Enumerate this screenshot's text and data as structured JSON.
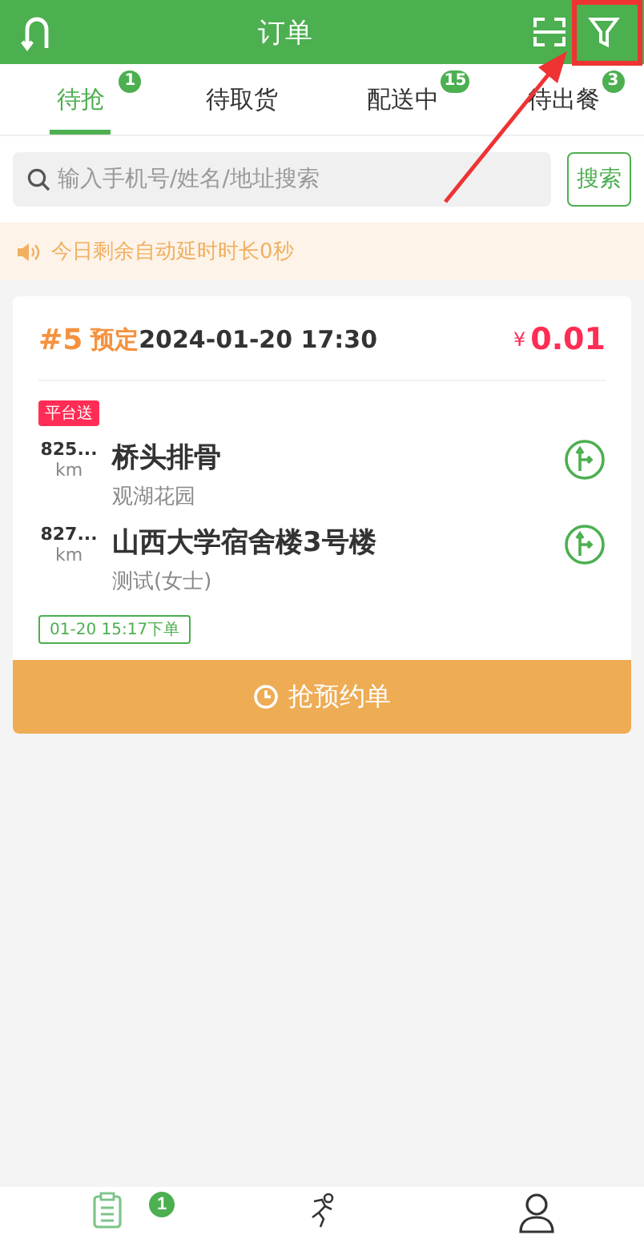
{
  "header": {
    "title": "订单"
  },
  "tabs": [
    {
      "label": "待抢",
      "badge": "1",
      "selected": true
    },
    {
      "label": "待取货",
      "selected": false
    },
    {
      "label": "配送中",
      "badge": "15",
      "selected": false
    },
    {
      "label": "待出餐",
      "badge": "3",
      "selected": false
    }
  ],
  "search": {
    "placeholder": "输入手机号/姓名/地址搜索",
    "button": "搜索"
  },
  "notice": "今日剩余自动延时时长0秒",
  "orders": [
    {
      "number": "#5",
      "type": "预定",
      "time": "2024-01-20 17:30",
      "currency": "¥",
      "price": "0.01",
      "tag": "平台送",
      "stops": [
        {
          "distance": "825...",
          "unit": "km",
          "name": "桥头排骨",
          "detail": "观湖花园"
        },
        {
          "distance": "827...",
          "unit": "km",
          "name": "山西大学宿舍楼3号楼",
          "detail": "测试(女士)"
        }
      ],
      "placed": "01-20 15:17下单",
      "action": "抢预约单"
    }
  ],
  "nav": [
    {
      "kind": "orders",
      "badge": "1",
      "selected": true
    },
    {
      "kind": "runner",
      "selected": false
    },
    {
      "kind": "profile",
      "selected": false
    }
  ]
}
